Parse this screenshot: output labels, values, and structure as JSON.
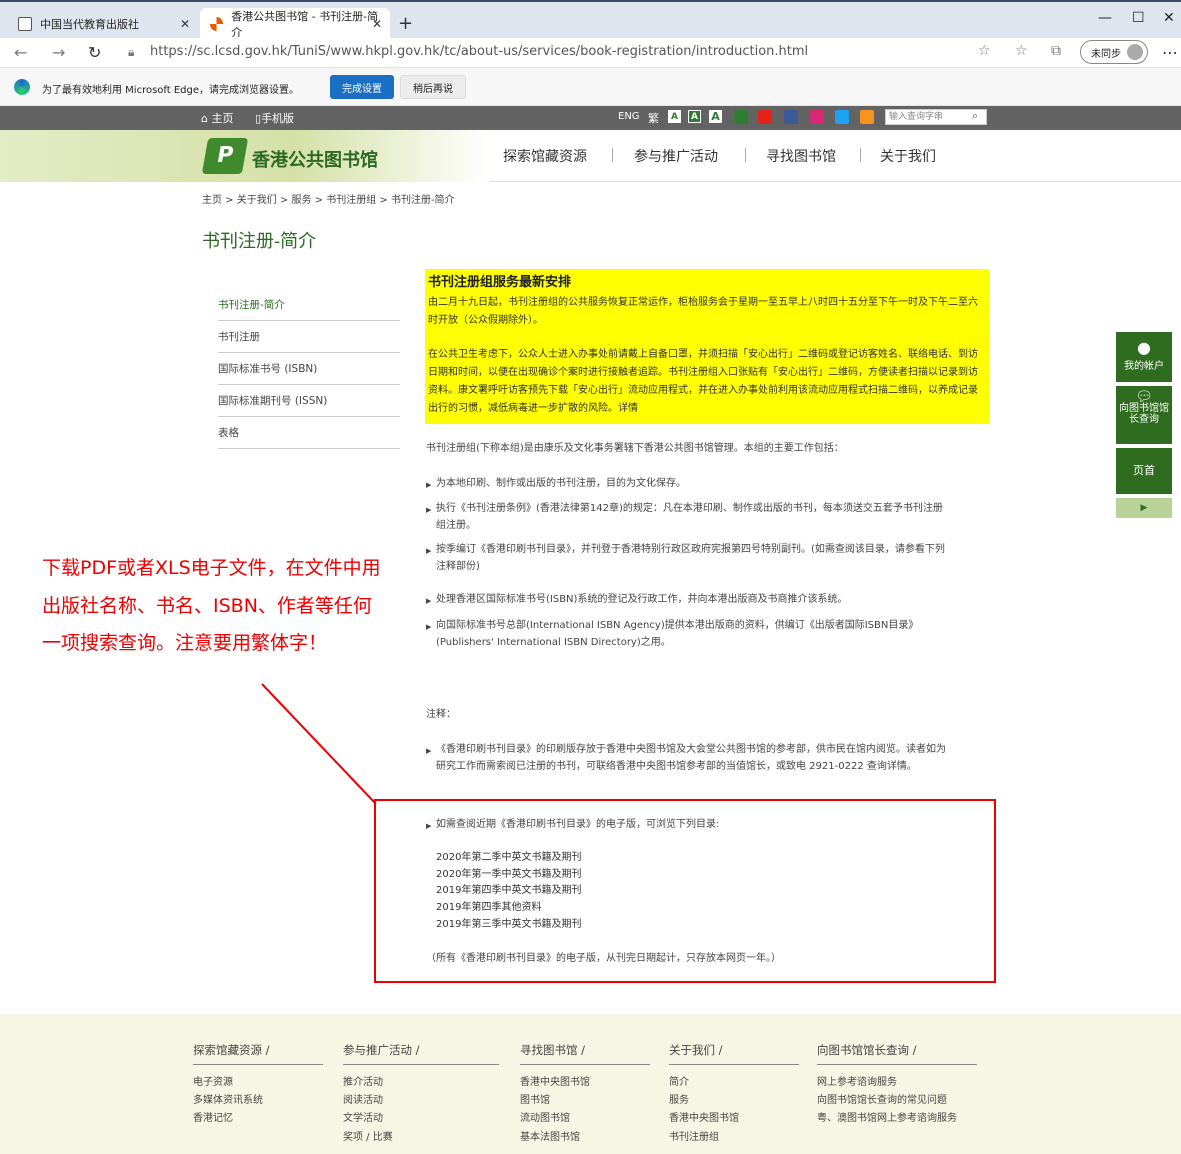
{
  "browser": {
    "tabs": [
      {
        "label": "中国当代教育出版社",
        "active": false
      },
      {
        "label": "香港公共图书馆 - 书刊注册-简介",
        "active": true
      }
    ],
    "url": "https://sc.lcsd.gov.hk/TuniS/www.hkpl.gov.hk/tc/about-us/services/book-registration/introduction.html",
    "sync_label": "未同步",
    "infobar": {
      "message": "为了最有效地利用 Microsoft Edge，请完成浏览器设置。",
      "primary": "完成设置",
      "secondary": "稍后再说"
    }
  },
  "site": {
    "topbar": {
      "home": "主页",
      "mobile": "手机版",
      "eng": "ENG",
      "trad": "繁",
      "search_placeholder": "输入查询字串"
    },
    "logo": "香港公共图书馆",
    "nav": [
      "探索馆藏资源",
      "参与推广活动",
      "寻找图书馆",
      "关于我们"
    ],
    "breadcrumb": "主页 > 关于我们 > 服务 > 书刊注册组 >  书刊注册-简介",
    "page_title": "书刊注册-简介",
    "sidebar": [
      "书刊注册-简介",
      "书刊注册",
      "国际标准书号 (ISBN)",
      "国际标准期刊号 (ISSN)",
      "表格"
    ],
    "notice": {
      "title": "书刊注册组服务最新安排",
      "p1": "由二月十九日起，书刊注册组的公共服务恢复正常运作，柜枱服务会于星期一至五早上八时四十五分至下午一时及下午二至六时开放（公众假期除外）。",
      "p2": "在公共卫生考虑下，公众人士进入办事处前请戴上自备口罩，并须扫描「安心出行」二维码或登记访客姓名、联络电话、到访日期和时间，以便在出现确诊个案时进行接触者追踪。书刊注册组入口张贴有「安心出行」二维码，方便读者扫描以记录到访资料。康文署呼吁访客预先下载「安心出行」流动应用程式，并在进入办事处前利用该流动应用程式扫描二维码，以养成记录出行的习惯，减低病毒进一步扩散的风险。详情"
    },
    "intro": "书刊注册组(下称本组)是由康乐及文化事务署辖下香港公共图书馆管理。本组的主要工作包括：",
    "bullets": [
      "为本地印刷、制作或出版的书刊注册，目的为文化保存。",
      "执行《书刊注册条例》(香港法律第142章)的规定：凡在本港印刷、制作或出版的书刊，每本须送交五套予书刊注册组注册。",
      "按季编订《香港印刷书刊目录》，并刊登于香港特别行政区政府宪报第四号特别副刊。(如需查阅该目录，请参看下列注释部份)",
      "处理香港区国际标准书号(ISBN)系统的登记及行政工作，并向本港出版商及书商推介该系统。",
      "向国际标准书号总部(International ISBN Agency)提供本港出版商的资料，供编订《出版者国际ISBN目录》(Publishers' International ISBN Directory)之用。"
    ],
    "notes_label": "注释：",
    "note1": "《香港印刷书刊目录》的印刷版存放于香港中央图书馆及大会堂公共图书馆的参考部，供市民在馆内阅览。读者如为研究工作而需索阅已注册的书刊，可联络香港中央图书馆参考部的当值馆长，或致电 2921-0222 查询详情。",
    "note2": "如需查阅近期《香港印刷书刊目录》的电子版，可浏览下列目录:",
    "catalog_links": [
      "2020年第二季中英文书籍及期刊",
      "2020年第一季中英文书籍及期刊",
      "2019年第四季中英文书籍及期刊",
      "2019年第四季其他资料",
      "2019年第三季中英文书籍及期刊"
    ],
    "retention_note": "（所有《香港印刷书刊目录》的电子版，从刊完日期起计，只存放本网页一年。）",
    "side_widgets": [
      "我的帐户",
      "向图书馆馆长查询",
      "页首"
    ],
    "footer": [
      {
        "heading": "探索馆藏资源 /",
        "items": [
          "电子资源",
          "多媒体资讯系统",
          "香港记忆"
        ]
      },
      {
        "heading": "参与推广活动 /",
        "items": [
          "推介活动",
          "阅读活动",
          "文学活动",
          "奖项 / 比赛"
        ]
      },
      {
        "heading": "寻找图书馆 /",
        "items": [
          "香港中央图书馆",
          "图书馆",
          "流动图书馆",
          "基本法图书馆"
        ]
      },
      {
        "heading": "关于我们 /",
        "items": [
          "简介",
          "服务",
          "香港中央图书馆",
          "书刊注册组"
        ]
      },
      {
        "heading": "向图书馆馆长查询 /",
        "items": [
          "网上参考谘询服务",
          "向图书馆馆长查询的常见问题",
          "粤、澳图书馆网上参考谘询服务"
        ]
      }
    ]
  },
  "annotation": "下载PDF或者XLS电子文件，在文件中用出版社名称、书名、ISBN、作者等任何一项搜索查询。注意要用繁体字！",
  "colors": {
    "site_green": "#2b6a22",
    "notice_bg": "#ffff00",
    "annotation_red": "#e00000",
    "edge_blue": "#1a6fc4"
  }
}
